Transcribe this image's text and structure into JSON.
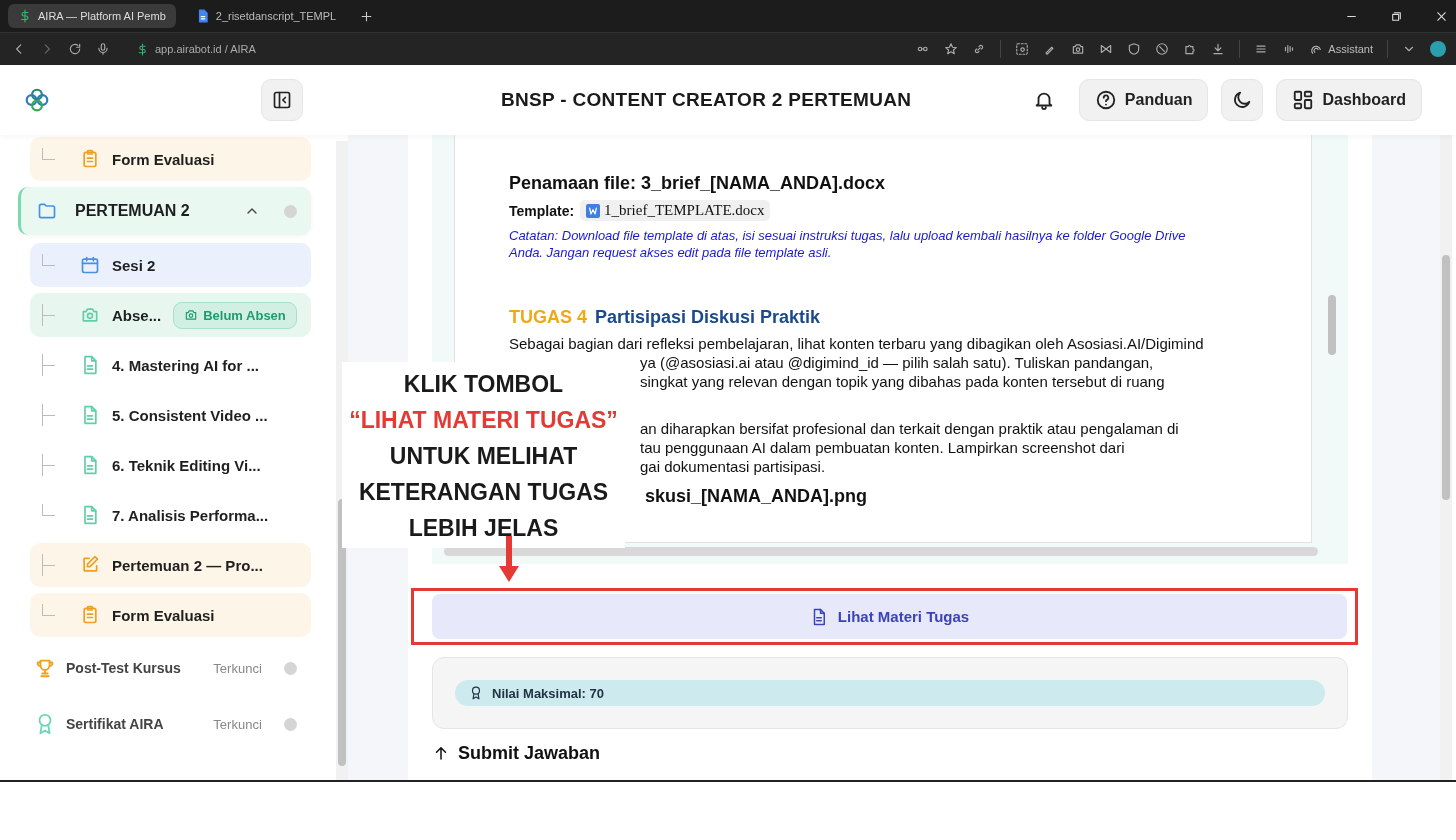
{
  "browser": {
    "tabs": [
      {
        "title": "AIRA — Platform AI Pemb",
        "kind": "app",
        "selected": true
      },
      {
        "title": "2_risetdanscript_TEMPL",
        "kind": "doc",
        "selected": false
      }
    ],
    "address": "app.airabot.id / AIRA",
    "assistant_label": "Assistant"
  },
  "header": {
    "title": "BNSP - CONTENT CREATOR 2 PERTEMUAN",
    "buttons": [
      {
        "label": "Panduan",
        "kind": "help"
      },
      {
        "label": "Dashboard",
        "kind": "dashboard"
      }
    ]
  },
  "sidebar": {
    "items": [
      {
        "kind": "form",
        "label": "Form Evaluasi",
        "last": true
      },
      {
        "kind": "section",
        "label": "PERTEMUAN 2",
        "expanded": true,
        "children": [
          {
            "kind": "session",
            "label": "Sesi 2",
            "last": true
          },
          {
            "kind": "attendance",
            "label": "Abse...",
            "badge": "Belum Absen",
            "last": false
          },
          {
            "kind": "material",
            "label": "4. Mastering AI for ...",
            "last": false
          },
          {
            "kind": "material",
            "label": "5. Consistent Video ...",
            "last": false
          },
          {
            "kind": "material",
            "label": "6. Teknik Editing Vi...",
            "last": false
          },
          {
            "kind": "material",
            "label": "7. Analisis Performa...",
            "last": true
          },
          {
            "kind": "task",
            "label": "Pertemuan 2 — Pro...",
            "last": false
          },
          {
            "kind": "form",
            "label": "Form Evaluasi",
            "last": true
          }
        ]
      }
    ],
    "footer_items": [
      {
        "kind": "posttest",
        "label": "Post-Test Kursus",
        "status": "Terkunci"
      },
      {
        "kind": "certificate",
        "label": "Sertifikat AIRA",
        "status": "Terkunci"
      }
    ]
  },
  "document": {
    "file_heading": "Penamaan file: 3_brief_[NAMA_ANDA].docx",
    "template_label": "Template:",
    "template_file": "1_brief_TEMPLATE.docx",
    "note": "Catatan: Download file template di atas, isi sesuai instruksi tugas, lalu upload kembali hasilnya ke folder Google Drive Anda. Jangan request akses edit pada file template asli.",
    "task_number": "TUGAS 4",
    "task_title": "Partisipasi Diskusi Praktik",
    "paragraphs": [
      {
        "lines": [
          {
            "text": "Sebagai bagian dari refleksi pembelajaran, lihat konten terbaru yang dibagikan oleh Asosiasi.AI/Digimind",
            "kind": "full"
          },
          {
            "text": "ya (@asosiasi.ai atau @digimind_id — pilih salah satu). Tuliskan pandangan,",
            "kind": "partial"
          },
          {
            "text": "singkat yang relevan dengan topik yang dibahas pada konten tersebut di ruang",
            "kind": "partial"
          }
        ]
      },
      {
        "lines": [
          {
            "text": "an diharapkan bersifat profesional dan terkait dengan praktik atau pengalaman di",
            "kind": "partial"
          },
          {
            "text": "tau penggunaan AI dalam pembuatan konten. Lampirkan screenshot dari",
            "kind": "partial"
          },
          {
            "text": "gai dokumentasi partisipasi.",
            "kind": "partial"
          }
        ]
      }
    ],
    "file_line": "skusi_[NAMA_ANDA].png"
  },
  "action_button": "Lihat Materi Tugas",
  "score": "Nilai Maksimal: 70",
  "submit_heading": "Submit Jawaban",
  "callout": {
    "lines": [
      {
        "text": "KLIK TOMBOL",
        "emphasis": false
      },
      {
        "text": "“LIHAT MATERI TUGAS”",
        "emphasis": true
      },
      {
        "text": "UNTUK MELIHAT",
        "emphasis": false
      },
      {
        "text": "KETERANGAN TUGAS",
        "emphasis": false
      },
      {
        "text": "LEBIH JELAS",
        "emphasis": false
      }
    ]
  }
}
